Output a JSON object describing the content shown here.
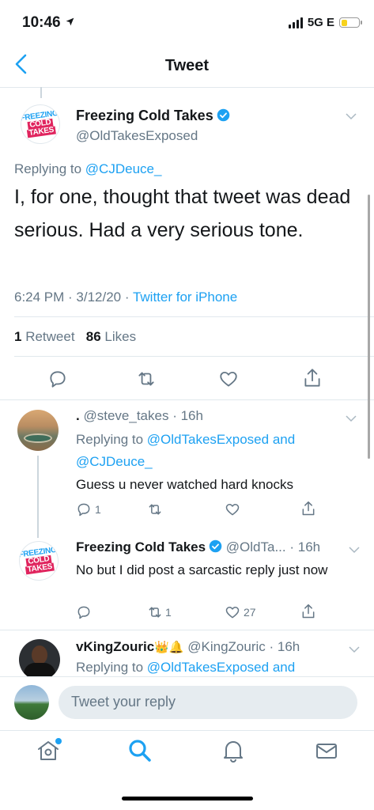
{
  "status_bar": {
    "time": "10:46",
    "network": "5G E"
  },
  "nav": {
    "title": "Tweet"
  },
  "main_tweet": {
    "logo": {
      "line1": "FREEZING",
      "line2": "COLD",
      "line3": "TAKES"
    },
    "author_name": "Freezing Cold Takes",
    "author_handle": "@OldTakesExposed",
    "replying_label": "Replying to",
    "replying_handle": "@CJDeuce_",
    "text": "I, for one, thought that tweet was dead serious. Had a very serious tone.",
    "time": "6:24 PM · 3/12/20 · ",
    "source": "Twitter for iPhone",
    "retweets_count": "1",
    "retweets_label": "Retweet",
    "likes_count": "86",
    "likes_label": "Likes"
  },
  "replies": [
    {
      "name": ".",
      "handle": "@steve_takes",
      "time": "· 16h",
      "replying_label": "Replying to",
      "replying_handles": "@OldTakesExposed and @CJDeuce_",
      "replying_and": "and",
      "replying_h1": "@OldTakesExposed",
      "replying_h2": "@CJDeuce_",
      "text": "Guess u never watched hard knocks",
      "reply_count": "1",
      "retweet_count": "",
      "like_count": ""
    },
    {
      "logo": {
        "line1": "FREEZING",
        "line2": "COLD",
        "line3": "TAKES"
      },
      "name": "Freezing Cold Takes",
      "handle": "@OldTa...",
      "time": "· 16h",
      "text": "No but I did post a sarcastic reply just now",
      "reply_count": "",
      "retweet_count": "1",
      "like_count": "27"
    },
    {
      "name": "vKingZouric",
      "emoji": "👑🔔",
      "handle": "@KingZouric",
      "time": "· 16h",
      "replying_label": "Replying to",
      "replying_h1": "@OldTakesExposed",
      "replying_and": "and"
    }
  ],
  "compose": {
    "placeholder": "Tweet your reply"
  },
  "colors": {
    "accent": "#1da1f2",
    "like": "#e0245e",
    "text": "#14171a",
    "secondary": "#657786"
  },
  "icons": [
    "back-chevron-icon",
    "verified-icon",
    "chevron-down-icon",
    "reply-icon",
    "retweet-icon",
    "heart-icon",
    "share-icon",
    "home-icon",
    "search-icon",
    "bell-icon",
    "mail-icon"
  ]
}
